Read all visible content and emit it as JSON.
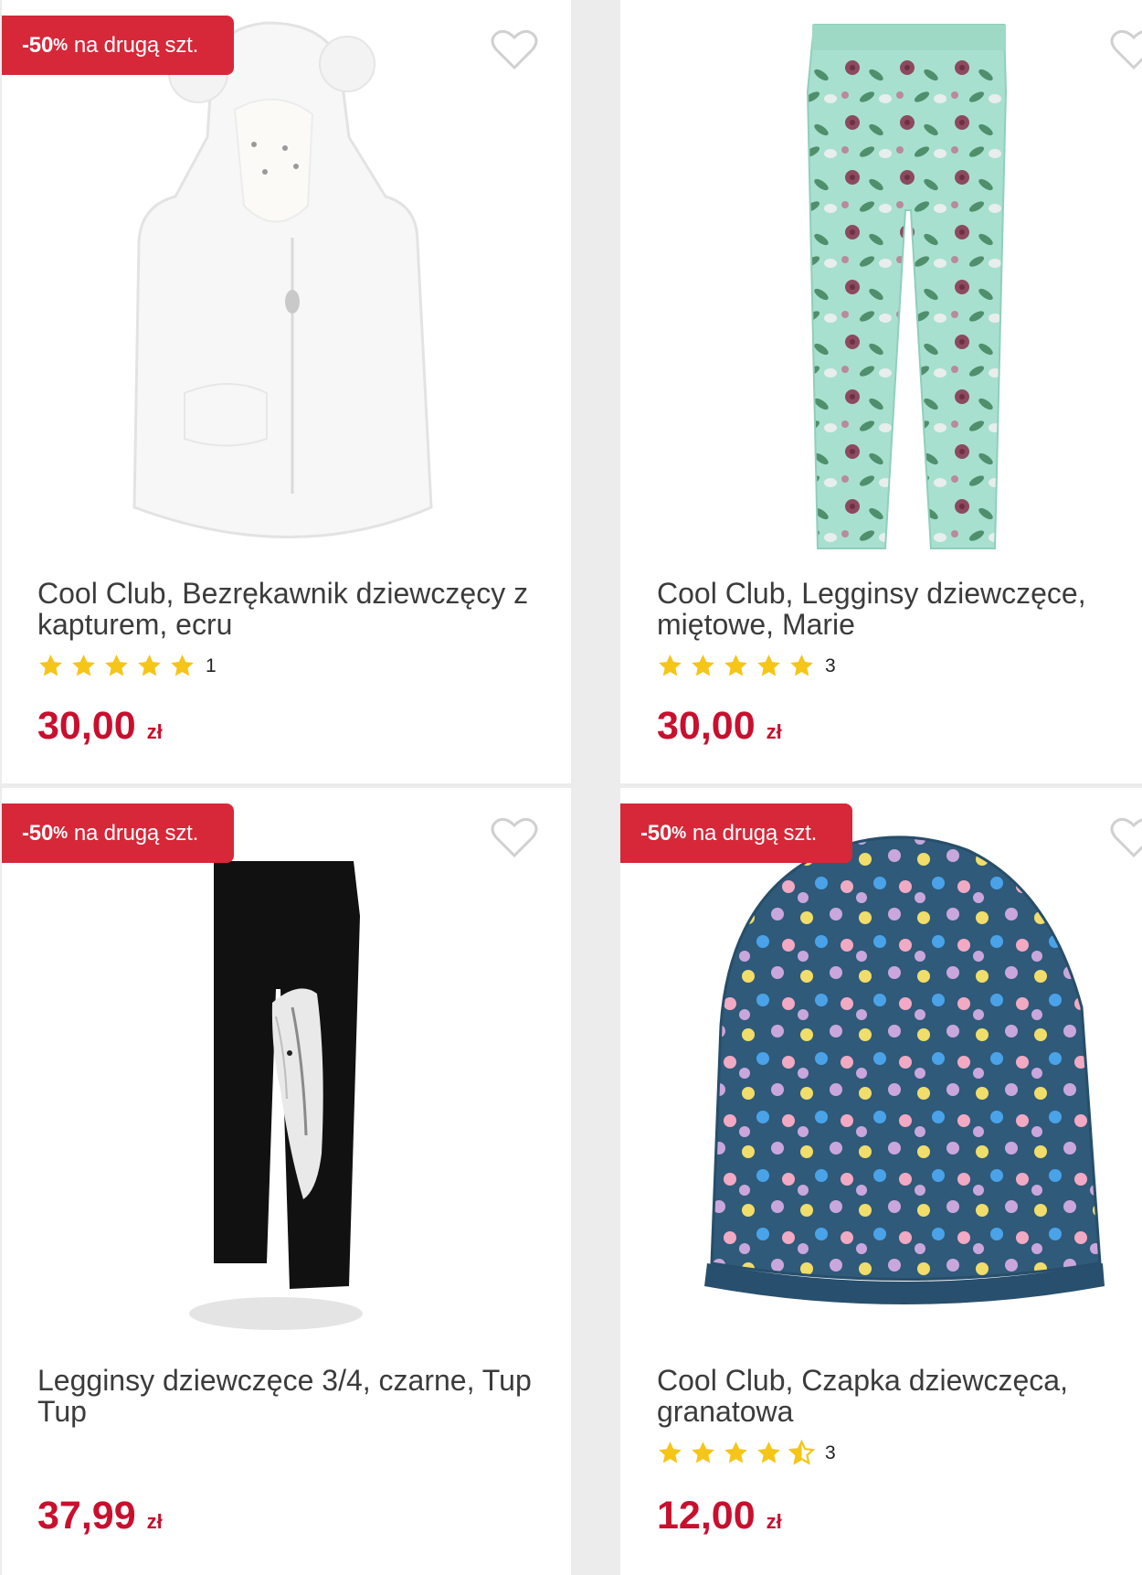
{
  "products": [
    {
      "badge_strong": "-50",
      "badge_pct": "%",
      "badge_rest": "na drugą szt.",
      "title": "Cool Club, Bezrękawnik dziewczęcy z kapturem, ecru",
      "rating": 5,
      "rating_count": "1",
      "price": "30,00",
      "currency": "zł",
      "image_icon": "white-fur-vest-image"
    },
    {
      "title": "Cool Club, Legginsy dziewczęce, miętowe, Marie",
      "rating": 5,
      "rating_count": "3",
      "price": "30,00",
      "currency": "zł",
      "image_icon": "mint-floral-leggings-image"
    },
    {
      "badge_strong": "-50",
      "badge_pct": "%",
      "badge_rest": "na drugą szt.",
      "title": "Legginsy dziewczęce 3/4, czarne, Tup Tup",
      "price": "37,99",
      "currency": "zł",
      "image_icon": "black-horse-leggings-image"
    },
    {
      "badge_strong": "-50",
      "badge_pct": "%",
      "badge_rest": "na drugą szt.",
      "title": "Cool Club, Czapka dziewczęca, granatowa",
      "rating": 4.5,
      "rating_count": "3",
      "price": "12,00",
      "currency": "zł",
      "image_icon": "navy-polka-dot-beanie-image"
    }
  ],
  "colors": {
    "badge_bg": "#d62839",
    "price": "#c8102e",
    "star": "#f5c518"
  },
  "icons": {
    "favorite": "heart-outline-icon",
    "rating": "star-icon"
  }
}
